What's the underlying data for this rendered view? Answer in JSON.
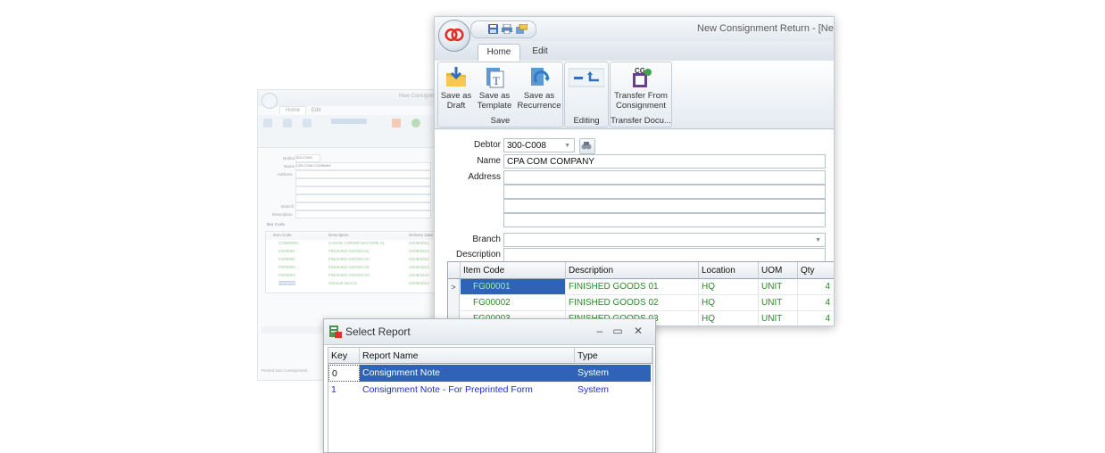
{
  "background_window": {
    "title": "New Consignm",
    "tabs": [
      "Home",
      "Edit"
    ],
    "fields": {
      "debtor_label": "Debtor",
      "debtor_value": "300-C008",
      "name_label": "Name",
      "name_value": "CPA COM COMPANY",
      "address_label": "Address",
      "branch_label": "Branch",
      "description_label": "Description"
    },
    "section_label": "Bar Code",
    "columns": [
      "Item Code",
      "Description",
      "Delivery Date"
    ],
    "rows": [
      [
        "CON00001",
        "CANON COPIER MACHINE 01",
        "22/08/2013"
      ],
      [
        "FG00001",
        "FINISHED GOODS 01",
        "22/08/2013"
      ],
      [
        "FG00002",
        "FINISHED GOODS 02",
        "22/08/2013"
      ],
      [
        "FG00003",
        "FINISHED GOODS 03",
        "22/08/2013"
      ],
      [
        "FG00004",
        "FINISHED GOODS 04",
        "22/08/2013"
      ],
      [
        "FG00005",
        "General Item 01",
        "22/08/2013"
      ]
    ],
    "footer_checkbox": "Printed Non Consignment"
  },
  "main_window": {
    "title": "New Consignment Return - [Ne",
    "tabs": {
      "home": "Home",
      "edit": "Edit"
    },
    "ribbon": {
      "save_as_draft": [
        "Save as",
        "Draft"
      ],
      "save_as_template": [
        "Save as",
        "Template"
      ],
      "save_as_recurrence": [
        "Save as",
        "Recurrence"
      ],
      "save_group": "Save",
      "editing_group": "Editing",
      "transfer_from_consignment": [
        "Transfer From",
        "Consignment"
      ],
      "transfer_group": "Transfer Docu..."
    },
    "form": {
      "debtor_label": "Debtor",
      "debtor_value": "300-C008",
      "name_label": "Name",
      "name_value": "CPA COM COMPANY",
      "address_label": "Address",
      "branch_label": "Branch",
      "description_label": "Description"
    },
    "grid": {
      "columns": [
        "Item Code",
        "Description",
        "Location",
        "UOM",
        "Qty"
      ],
      "rows": [
        {
          "item_code": "FG00001",
          "description": "FINISHED GOODS 01",
          "location": "HQ",
          "uom": "UNIT",
          "qty": "4",
          "selected": true
        },
        {
          "item_code": "FG00002",
          "description": "FINISHED GOODS 02",
          "location": "HQ",
          "uom": "UNIT",
          "qty": "4",
          "selected": false
        },
        {
          "item_code": "FG00003",
          "description": "FINISHED GOODS 03",
          "location": "HQ",
          "uom": "UNIT",
          "qty": "4",
          "selected": false
        }
      ]
    }
  },
  "select_report": {
    "title": "Select Report",
    "columns": [
      "Key",
      "Report Name",
      "Type"
    ],
    "rows": [
      {
        "key": "0",
        "name": "Consignment Note",
        "type": "System",
        "selected": true
      },
      {
        "key": "1",
        "name": "Consignment Note - For Preprinted Form",
        "type": "System",
        "selected": false
      }
    ]
  },
  "colors": {
    "selection": "#2f63b6",
    "item_text": "#2a8a2a",
    "link_text": "#1f2fd6"
  }
}
